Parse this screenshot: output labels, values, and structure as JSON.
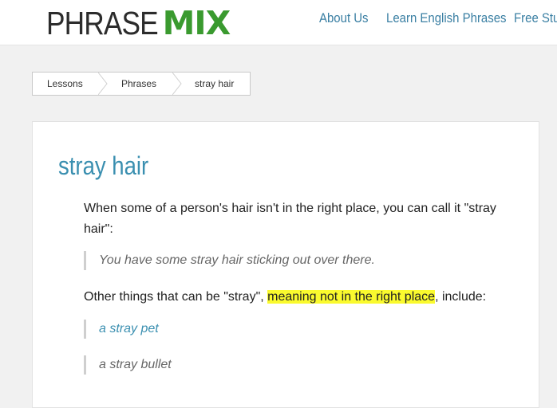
{
  "header": {
    "logo_phrase": "PHRASE",
    "logo_mix": "MIX",
    "nav": [
      "About Us",
      "Learn English Phrases",
      "Free Stuf"
    ]
  },
  "breadcrumb": [
    "Lessons",
    "Phrases",
    "stray hair"
  ],
  "article": {
    "title": "stray hair",
    "intro_line1": "When some of a person's hair isn't in the right place, you can call it \"stray",
    "intro_line2": "hair\":",
    "example": "You have some stray hair sticking out over there.",
    "other_before": "Other things that can be \"stray\", ",
    "other_highlight": "meaning not in the right place",
    "other_after": ", include:",
    "examples": [
      "a stray pet",
      "a stray bullet"
    ]
  },
  "colors": {
    "accent": "#3a8fb0",
    "logo_green": "#3a9a2f",
    "highlight": "#fafa2e"
  }
}
